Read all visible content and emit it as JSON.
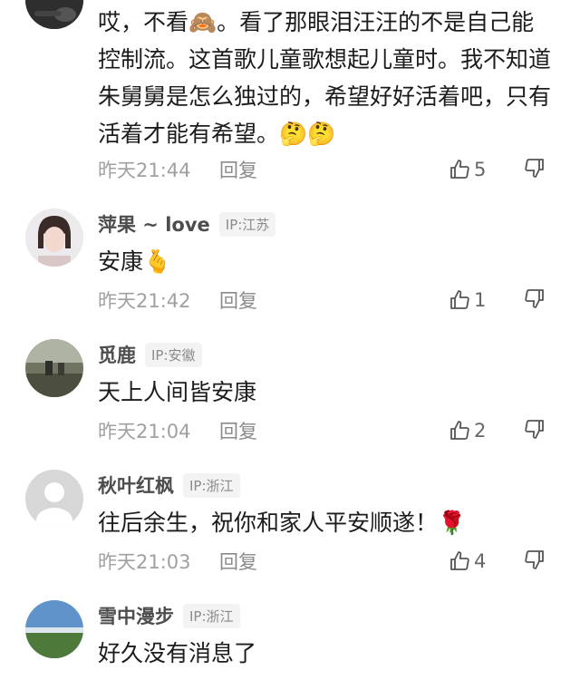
{
  "comments": [
    {
      "text": "哎，不看🙈。看了那眼泪汪汪的不是自己能控制流。这首歌儿童歌想起儿童时。我不知道朱舅舅是怎么独过的，希望好好活着吧，只有活着才能有希望。🤔🤔",
      "time": "昨天21:44",
      "reply": "回复",
      "likes": "5"
    },
    {
      "name": "萍果 ~ love",
      "ip": "IP:江苏",
      "text": "安康🫰",
      "time": "昨天21:42",
      "reply": "回复",
      "likes": "1"
    },
    {
      "name": "觅鹿",
      "ip": "IP:安徽",
      "text": "天上人间皆安康",
      "time": "昨天21:04",
      "reply": "回复",
      "likes": "2"
    },
    {
      "name": "秋叶红枫",
      "ip": "IP:浙江",
      "text": "往后余生，祝你和家人平安顺遂！🌹",
      "time": "昨天21:03",
      "reply": "回复",
      "likes": "4"
    },
    {
      "name": "雪中漫步",
      "ip": "IP:浙江",
      "text": "好久没有消息了"
    }
  ],
  "icons": {
    "like": "thumbs-up-icon",
    "dislike": "thumbs-down-icon",
    "default_avatar": "default-avatar-icon"
  },
  "colors": {
    "username": "#4d4d4d",
    "meta": "#a0a0a0",
    "ip_bg": "#f3f3f3"
  }
}
